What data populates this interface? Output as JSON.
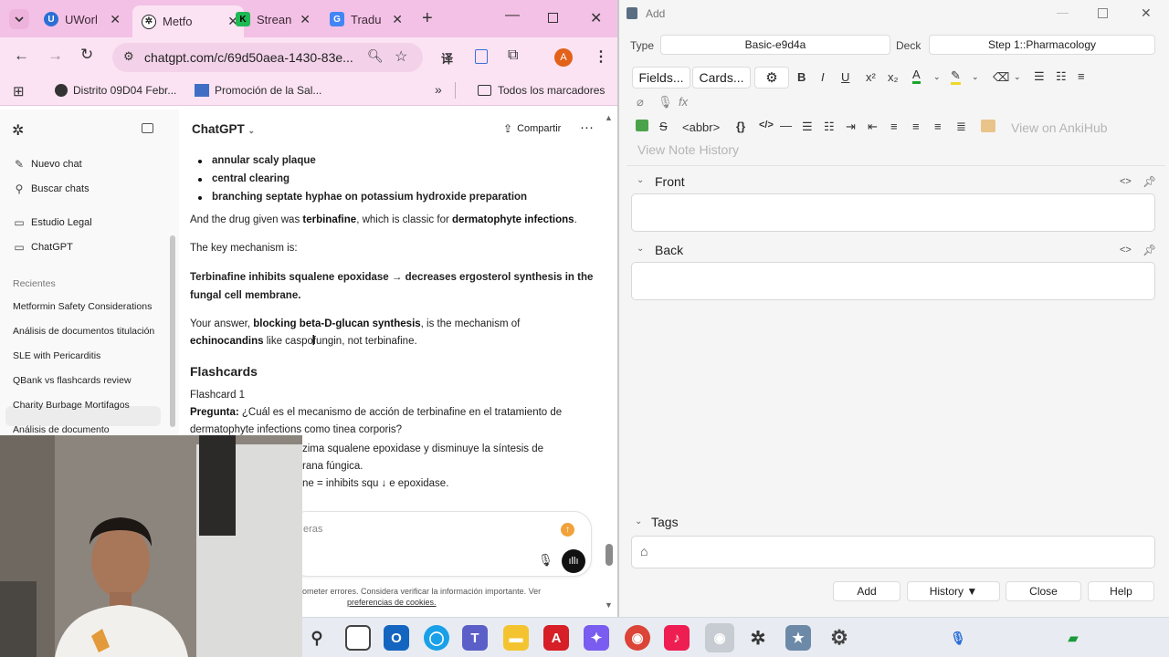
{
  "chrome": {
    "tabs": [
      {
        "title": "UWorl",
        "icon": "uworld-icon",
        "color": "#2b6fd6"
      },
      {
        "title": "Metfo",
        "icon": "chatgpt-icon",
        "color": "#111111"
      },
      {
        "title": "Strean",
        "icon": "stream-icon",
        "color": "#1db954"
      },
      {
        "title": "Tradu",
        "icon": "translate-icon",
        "color": "#4285f4"
      }
    ],
    "url": "chatgpt.com/c/69d50aea-1430-83e...",
    "profile_letter": "A",
    "bookmarks": [
      "Distrito 09D04 Febr...",
      "Promoción de la Sal...",
      "Todos los marcadores"
    ]
  },
  "chatgpt": {
    "brand": "ChatGPT",
    "share_label": "Compartir",
    "sidebar": {
      "new_chat": "Nuevo chat",
      "search": "Buscar chats",
      "projects": [
        "Estudio Legal",
        "ChatGPT"
      ],
      "recent_header": "Recientes",
      "recents": [
        "Metformin Safety Considerations",
        "Análisis de documentos titulación",
        "SLE with Pericarditis",
        "QBank vs flashcards review",
        "Charity Burbage Mortifagos",
        "Análisis de documento"
      ]
    },
    "message": {
      "bullets": [
        "annular scaly plaque",
        "central clearing",
        "branching septate hyphae on potassium hydroxide preparation"
      ],
      "drug_line": {
        "a": "And the drug given was ",
        "b": "terbinafine",
        "c": ", which is classic for ",
        "d": "dermatophyte infections",
        "e": "."
      },
      "key_mechanism": "The key mechanism is:",
      "mech1": "Terbinafine inhibits squalene epoxidase → decreases ergosterol synthesis in the",
      "mech2": "fungal cell membrane.",
      "answer1": {
        "a": "Your answer, ",
        "b": "blocking beta-D-glucan synthesis",
        "c": ", is the mechanism of"
      },
      "answer2": {
        "a": "echinocandins",
        "b": " like caspofungin, not terbinafine."
      },
      "flashcards_heading": "Flashcards",
      "flashcard1": "Flashcard 1",
      "pregunta_label": "Pregunta:",
      "pregunta_text": " ¿Cuál es el mecanismo de acción de terbinafine en el tratamiento de",
      "pregunta_cont": "dermatophyte infections como tinea corporis?",
      "resp1": "zima squalene epoxidase y disminuye la síntesis de",
      "resp2": "rana fúngica.",
      "resp3": "ne = inhibits squ",
      "resp3b": "e epoxidase."
    },
    "composer_placeholder": "eras",
    "disclaimer": "ometer errores. Considera verificar la información importante. Ver",
    "cookie_link": "preferencias de cookies."
  },
  "anki": {
    "window_title": "Add",
    "type_label": "Type",
    "type_value": "Basic-e9d4a",
    "deck_label": "Deck",
    "deck_value": "Step 1::Pharmacology",
    "fields_button": "Fields...",
    "cards_button": "Cards...",
    "abbr_label": "<abbr>",
    "braces_label": "{}",
    "code_label": "</>",
    "ankihub_label": "View on AnkiHub",
    "history_link": "View Note History",
    "front_label": "Front",
    "back_label": "Back",
    "tags_label": "Tags",
    "add_button": "Add",
    "history_button": "History ▼",
    "close_button": "Close",
    "help_button": "Help"
  }
}
